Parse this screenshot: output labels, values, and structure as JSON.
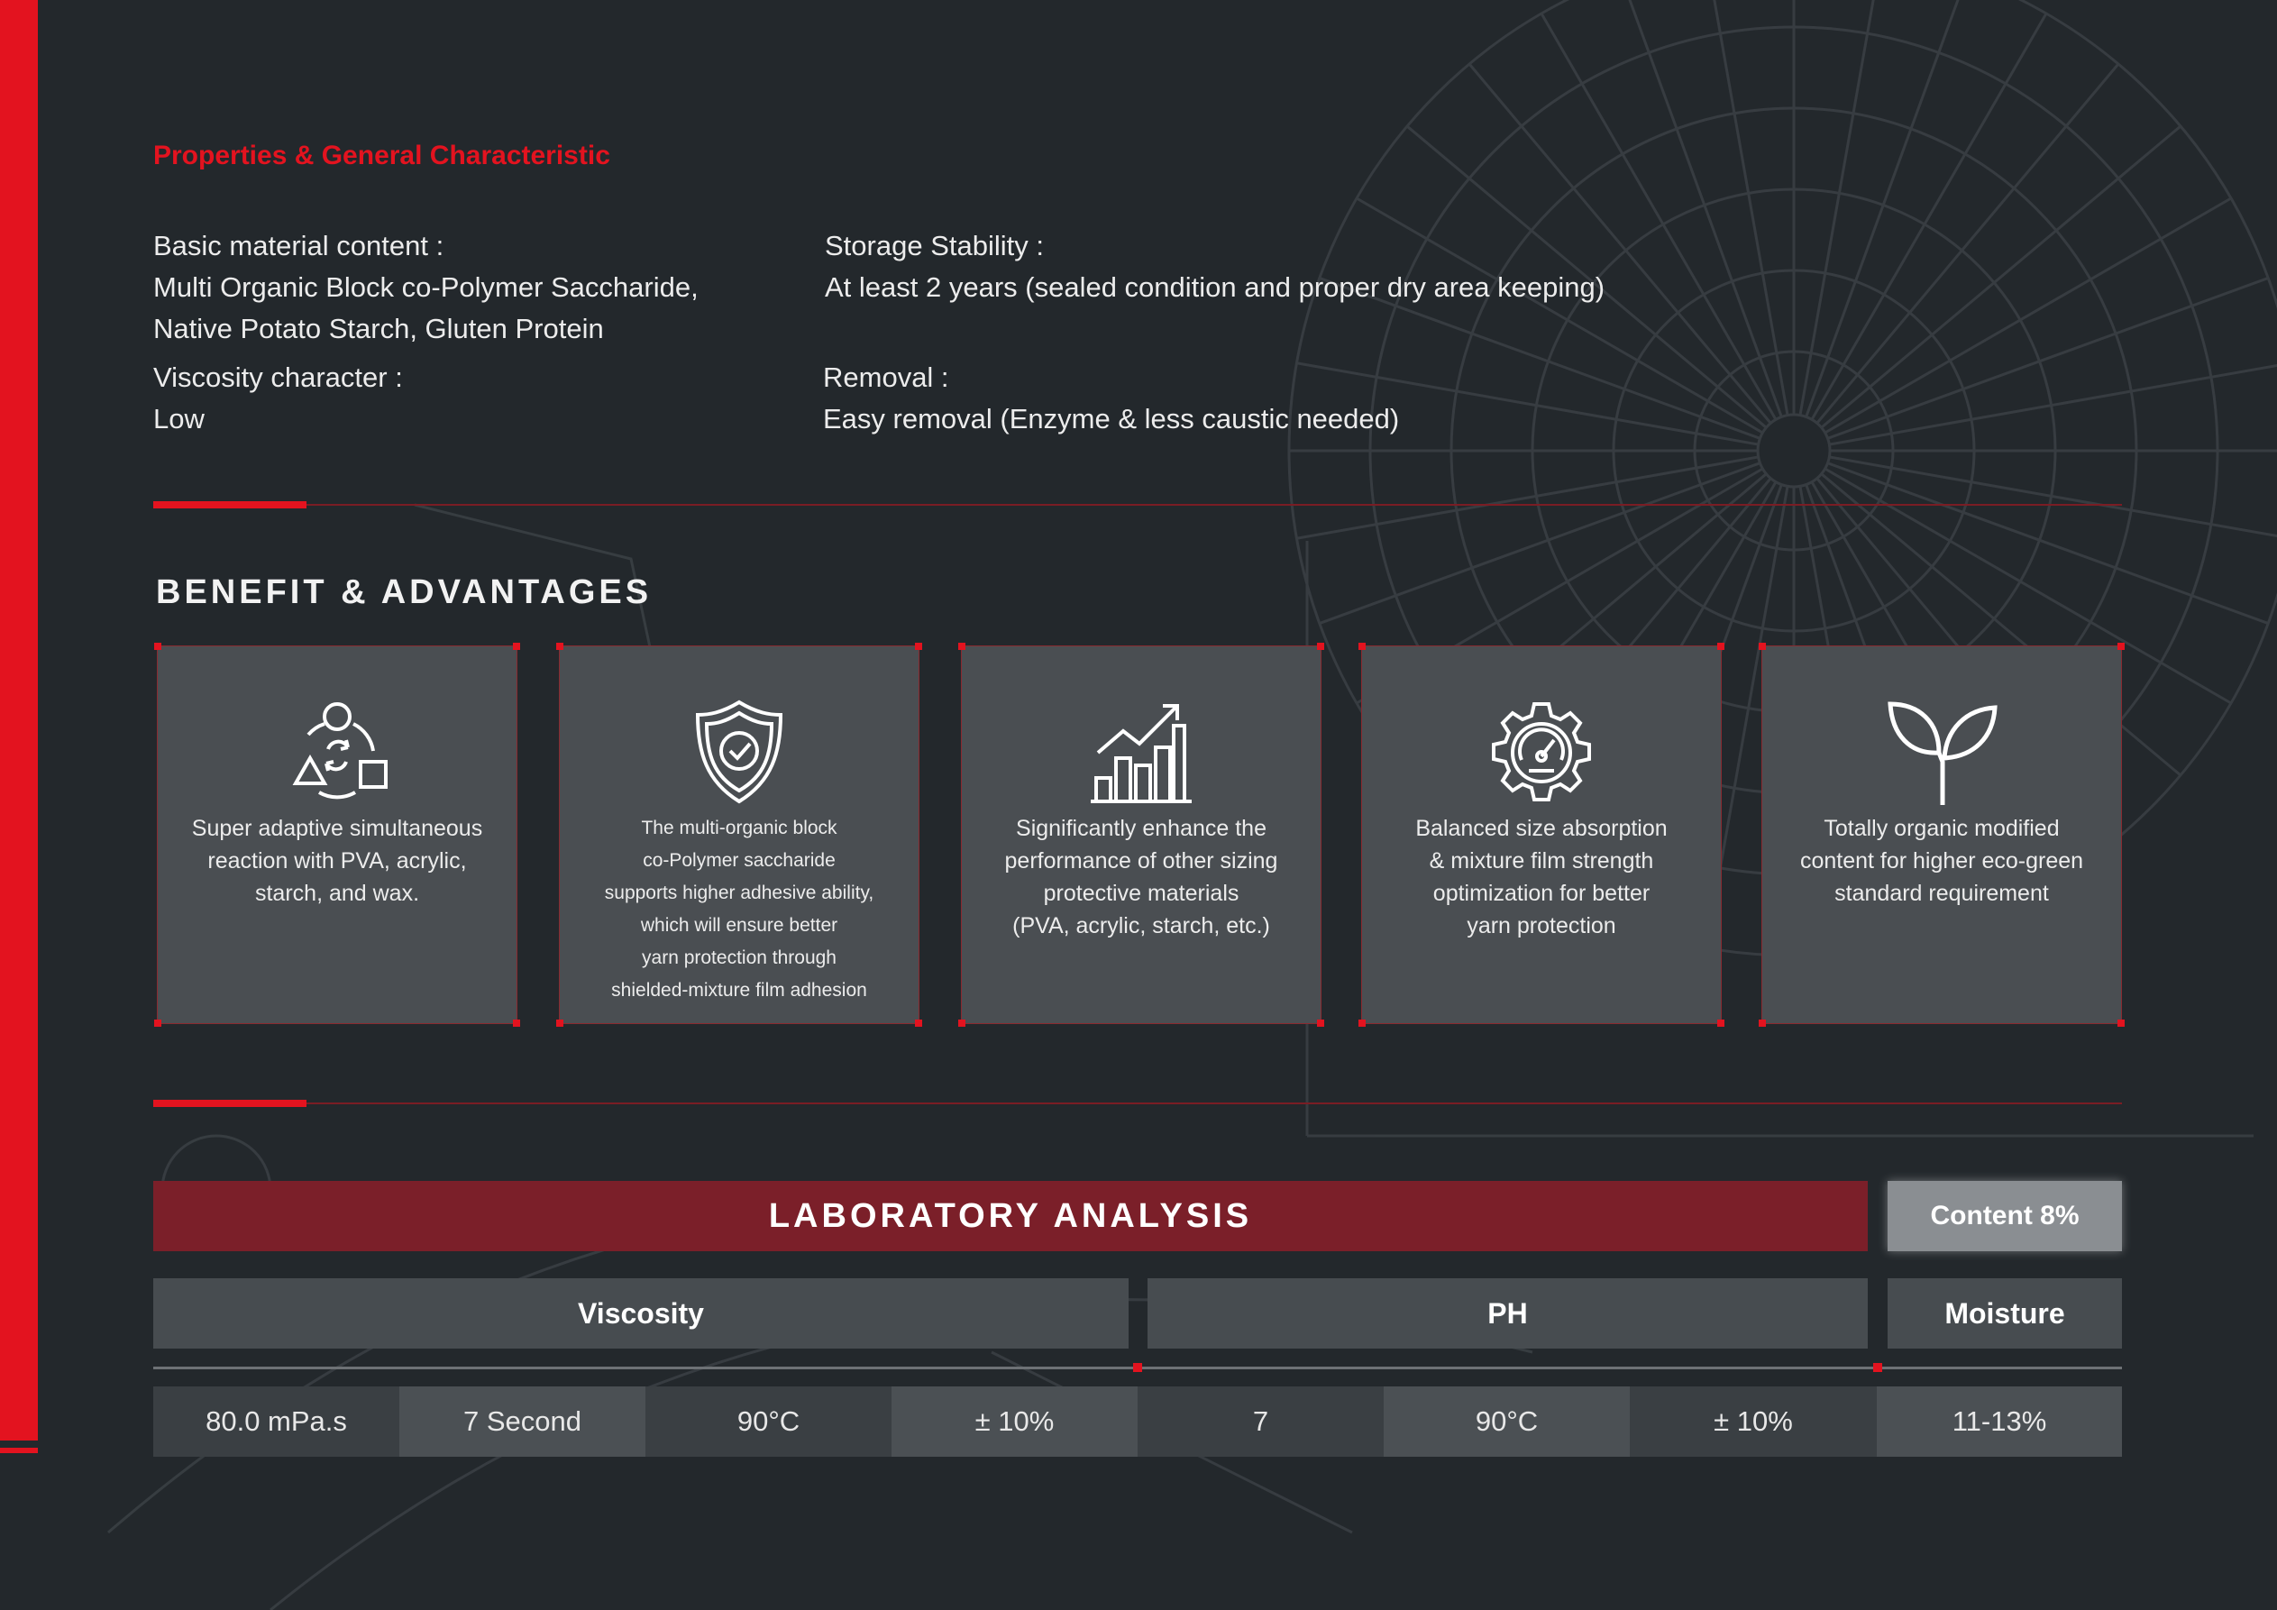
{
  "properties": {
    "title": "Properties & General Characteristic",
    "basic_material": {
      "label": "Basic material content :",
      "line1": "Multi Organic Block co-Polymer Saccharide,",
      "line2": "Native Potato Starch, Gluten Protein"
    },
    "storage": {
      "label": "Storage Stability :",
      "value": "At least 2 years (sealed condition and proper dry area keeping)"
    },
    "viscosity": {
      "label": "Viscosity character :",
      "value": "Low"
    },
    "removal": {
      "label": "Removal :",
      "value": "Easy removal (Enzyme & less caustic needed)"
    }
  },
  "benefits": {
    "heading": "BENEFIT & ADVANTAGES",
    "cards": [
      {
        "icon": "shapes-cycle-icon",
        "lines": [
          "Super adaptive simultaneous",
          "reaction with PVA, acrylic,",
          "starch, and wax."
        ]
      },
      {
        "icon": "shield-check-icon",
        "lines": [
          "The multi-organic block",
          "co-Polymer saccharide",
          "supports higher adhesive ability,",
          "which will ensure better",
          "yarn protection through",
          "shielded-mixture film adhesion"
        ]
      },
      {
        "icon": "growth-chart-icon",
        "lines": [
          "Significantly enhance the",
          "performance of other sizing",
          "protective materials",
          "(PVA, acrylic, starch, etc.)"
        ]
      },
      {
        "icon": "gear-gauge-icon",
        "lines": [
          "Balanced size absorption",
          "& mixture film strength",
          "optimization for better",
          "yarn protection"
        ]
      },
      {
        "icon": "leaf-sprout-icon",
        "lines": [
          "Totally organic modified",
          "content for higher eco-green",
          "standard requirement"
        ]
      }
    ]
  },
  "lab": {
    "title": "LABORATORY ANALYSIS",
    "content": "Content 8%",
    "headers": {
      "viscosity": "Viscosity",
      "ph": "PH",
      "moisture": "Moisture"
    },
    "values": [
      "80.0  mPa.s",
      "7 Second",
      "90°C",
      "± 10%",
      "7",
      "90°C",
      "± 10%",
      "11-13%"
    ]
  },
  "colors": {
    "accent": "#e3131f",
    "background": "#23282c",
    "lab_bar": "#7b1f29",
    "card": "#4a4e52"
  }
}
